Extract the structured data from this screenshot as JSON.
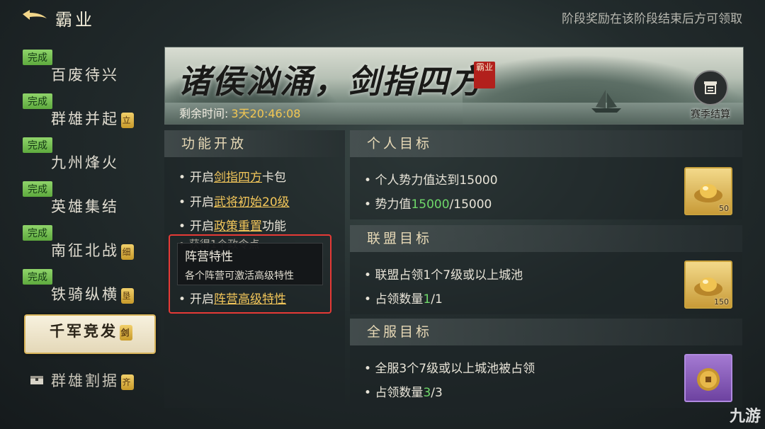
{
  "header": {
    "title": "霸业",
    "notice": "阶段奖励在该阶段结束后方可领取"
  },
  "sidebar": {
    "items": [
      {
        "badge": "完成",
        "label": "百废待兴"
      },
      {
        "badge": "完成",
        "label": "群雄并起",
        "seal": "立"
      },
      {
        "badge": "完成",
        "label": "九州烽火"
      },
      {
        "badge": "完成",
        "label": "英雄集结"
      },
      {
        "badge": "完成",
        "label": "南征北战",
        "seal": "细"
      },
      {
        "badge": "完成",
        "label": "铁骑纵横",
        "seal": "垦"
      },
      {
        "label": "千军竞发",
        "seal": "剑"
      },
      {
        "label": "群雄割据",
        "seal": "齐"
      }
    ]
  },
  "banner": {
    "title": "诸侯汹涌，剑指四方",
    "seal": "霸业",
    "countdown_label": "剩余时间:",
    "countdown_value": "3天20:46:08",
    "settle_label": "赛季结算"
  },
  "features": {
    "title": "功能开放",
    "lines": [
      {
        "prefix": "开启",
        "link": "剑指四方",
        "suffix": "卡包"
      },
      {
        "prefix": "开启",
        "link": "武将初始20级",
        "suffix": ""
      },
      {
        "prefix": "开启",
        "link": "政策重置",
        "suffix": "功能"
      },
      {
        "prefix": "开启",
        "link": "阵营高级特性",
        "suffix": ""
      }
    ],
    "partial_hidden": "获得1个政令点",
    "tooltip": {
      "title": "阵营特性",
      "desc": "各个阵营可激活高级特性"
    }
  },
  "goals": {
    "personal": {
      "title": "个人目标",
      "line1": "个人势力值达到15000",
      "line2_prefix": "势力值",
      "line2_current": "15000",
      "line2_total": "/15000",
      "reward_qty": "50"
    },
    "alliance": {
      "title": "联盟目标",
      "line1": "联盟占领1个7级或以上城池",
      "line2_prefix": "占领数量",
      "line2_current": "1",
      "line2_total": "/1",
      "reward_qty": "150"
    },
    "server": {
      "title": "全服目标",
      "line1": "全服3个7级或以上城池被占领",
      "line2_prefix": "占领数量",
      "line2_current": "3",
      "line2_total": "/3",
      "reward_qty": ""
    }
  },
  "watermark": "九游",
  "colors": {
    "accent_gold": "#f2c65a",
    "progress_green": "#6fd86a",
    "badge_green": "#5eaa3e",
    "highlight_red": "#e63a36"
  }
}
